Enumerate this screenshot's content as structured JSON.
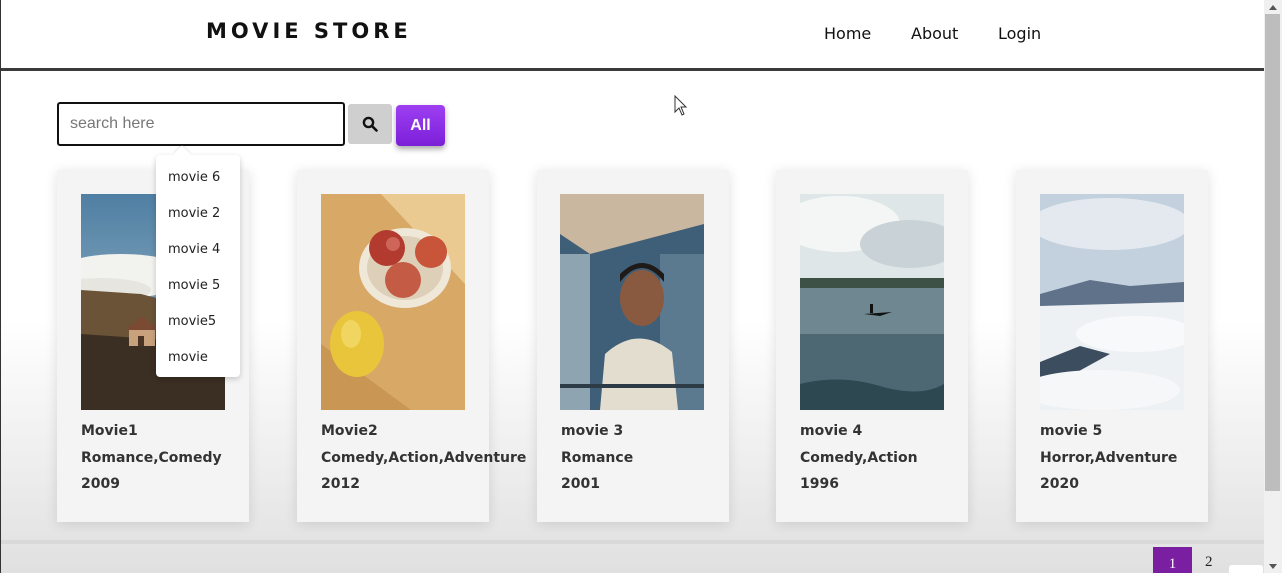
{
  "header": {
    "brand": "MOVIE STORE",
    "nav": [
      {
        "label": "Home"
      },
      {
        "label": "About"
      },
      {
        "label": "Login"
      }
    ]
  },
  "search": {
    "placeholder": "search here",
    "value": "",
    "search_icon": "search-icon",
    "all_label": "All"
  },
  "dropdown": {
    "items": [
      "movie 6",
      "movie 2",
      "movie 4",
      "movie 5",
      "movie5",
      "movie"
    ]
  },
  "movies": [
    {
      "name": "Movie1",
      "genre": "Romance,Comedy",
      "year": "2009"
    },
    {
      "name": "Movie2",
      "genre": "Comedy,Action,Adventure",
      "year": "2012"
    },
    {
      "name": "movie 3",
      "genre": "Romance",
      "year": "2001"
    },
    {
      "name": "movie 4",
      "genre": "Comedy,Action",
      "year": "1996"
    },
    {
      "name": "movie 5",
      "genre": "Horror,Adventure",
      "year": "2020"
    }
  ],
  "pagination": {
    "pages": [
      "1",
      "2"
    ],
    "current": "1"
  },
  "colors": {
    "accent": "#8e2de2",
    "page_active": "#7b1fa2",
    "header_border": "#3a3a3a"
  }
}
